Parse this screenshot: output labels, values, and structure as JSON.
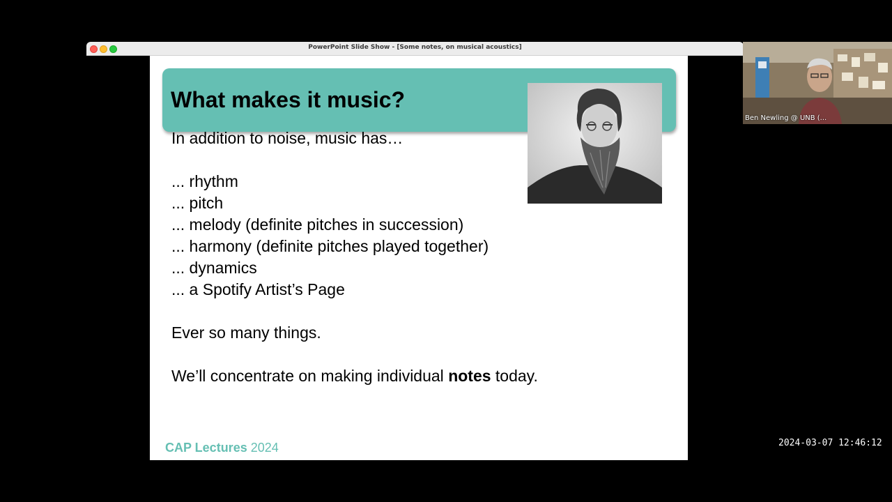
{
  "window": {
    "title": "PowerPoint Slide Show - [Some notes, on musical acoustics]"
  },
  "slide": {
    "title": "What makes it music?",
    "intro": "In addition to noise, music has…",
    "bullets": [
      "... rhythm",
      "... pitch",
      "... melody (definite pitches in succession)",
      "... harmony (definite pitches played together)",
      "... dynamics",
      "... a Spotify Artist’s Page"
    ],
    "summary": "Ever so many things.",
    "closing": {
      "before": "We’ll concentrate on making individual ",
      "bold": "notes",
      "after": " today."
    },
    "footer": {
      "bold": "CAP Lectures",
      "rest": " 2024"
    }
  },
  "video_tile": {
    "participant_name": "Ben Newling @ UNB (..."
  },
  "clock": "2024-03-07 12:46:12",
  "colors": {
    "accent": "#65bfb3",
    "background": "#000000"
  }
}
